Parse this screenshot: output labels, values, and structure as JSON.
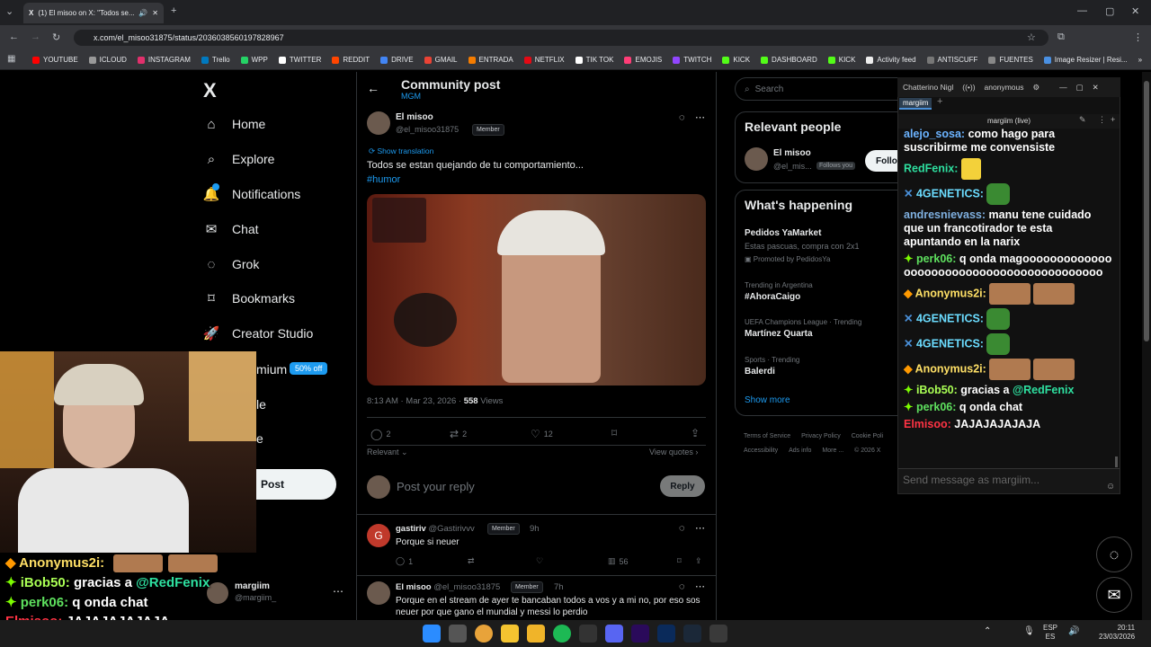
{
  "browser": {
    "tab_title": "(1) El misoo on X: \"Todos se...",
    "url": "x.com/el_misoo31875/status/2036038560197828967",
    "bookmarks": [
      "YOUTUBE",
      "ICLOUD",
      "INSTAGRAM",
      "Trello",
      "WPP",
      "TWITTER",
      "REDDIT",
      "DRIVE",
      "GMAIL",
      "ENTRADA",
      "NETFLIX",
      "TIK TOK",
      "EMOJIS",
      "TWITCH",
      "KICK",
      "DASHBOARD",
      "KICK",
      "Activity feed",
      "ANTISCUFF",
      "FUENTES",
      "Image Resizer | Resi..."
    ]
  },
  "sidebar": {
    "logo": "X",
    "items": [
      {
        "label": "Home",
        "icon": "⌂"
      },
      {
        "label": "Explore",
        "icon": "⌕"
      },
      {
        "label": "Notifications",
        "icon": "🔔"
      },
      {
        "label": "Chat",
        "icon": "✉"
      },
      {
        "label": "Grok",
        "icon": "◌"
      },
      {
        "label": "Bookmarks",
        "icon": "⌑"
      },
      {
        "label": "Creator Studio",
        "icon": "🚀"
      },
      {
        "label": "Premium",
        "icon": "X"
      },
      {
        "label": "Profile",
        "icon": "☺"
      },
      {
        "label": "More",
        "icon": "⋯"
      }
    ],
    "premium_visible": "mium",
    "premium_badge": "50% off",
    "profile_visible": "le",
    "more_visible": "e",
    "post_button": "Post",
    "account_name": "margiim",
    "account_handle": "@margiim_"
  },
  "header": {
    "title": "Community post",
    "subtitle": "MGM"
  },
  "post": {
    "author": "El misoo",
    "handle": "@el_misoo31875",
    "badge": "Member",
    "show_translation": "Show translation",
    "text": "Todos se estan quejando de tu comportamiento...",
    "hashtag": "#humor",
    "timestamp": "8:13 AM · Mar 23, 2026 · ",
    "views_count": "558",
    "views_label": " Views",
    "replies": "2",
    "reposts": "2",
    "likes": "12",
    "sort": "Relevant",
    "view_quotes": "View quotes",
    "reply_placeholder": "Post your reply",
    "reply_button": "Reply"
  },
  "replies": [
    {
      "author": "gastiriv",
      "handle": "@Gastirivvv",
      "badge": "Member",
      "time": "9h",
      "text": "Porque si neuer",
      "replies": "1",
      "views": "56"
    },
    {
      "author": "El misoo",
      "handle": "@el_misoo31875",
      "badge": "Member",
      "time": "7h",
      "text": "Porque en el stream de ayer te bancaban todos a vos y a mi no, por eso sos neuer por que gano el mundial y messi lo perdio"
    }
  ],
  "right": {
    "search_placeholder": "Search",
    "relevant_title": "Relevant people",
    "rp_name": "El misoo",
    "rp_handle": "@el_mis...",
    "rp_follows": "Follows you",
    "rp_follow": "Follo",
    "happening_title": "What's happening",
    "trends": [
      {
        "meta": "",
        "name": "Pedidos YaMarket",
        "desc": "Estas pascuas, compra con 2x1",
        "promo": "Promoted by PedidosYa"
      },
      {
        "meta": "Trending in Argentina",
        "name": "#AhoraCaigo"
      },
      {
        "meta": "UEFA Champions League · Trending",
        "name": "Martínez Quarta"
      },
      {
        "meta": "Sports · Trending",
        "name": "Balerdi"
      }
    ],
    "show_more": "Show more",
    "footer": [
      "Terms of Service",
      "Privacy Policy",
      "Cookie Poli",
      "Accessibility",
      "Ads info",
      "More ...",
      "© 2026 X"
    ]
  },
  "chatterino": {
    "title": "Chatterino Nigl",
    "user": "anonymous",
    "tab": "margiim",
    "channel": "margiim (live)",
    "input_placeholder": "Send message as margiim...",
    "lines": [
      {
        "user": "alejo_sosa:",
        "color": "#6bb3ff",
        "text": "como hago para suscribirme me convensiste"
      },
      {
        "user": "RedFenix:",
        "color": "#2ee0a0",
        "text": ""
      },
      {
        "user": "4GENETICS:",
        "color": "#6bdcff",
        "text": ""
      },
      {
        "user": "andresnievass:",
        "color": "#7fb0e0",
        "text": "manu tene cuidado que un francotirador te esta apuntando en la narix"
      },
      {
        "user": "perk06:",
        "color": "#5ee05e",
        "text": "q onda magoooooooooooooooooooooooooooooooooooooooooo"
      },
      {
        "user": "Anonymus2i:",
        "color": "#ffe066",
        "text": ""
      },
      {
        "user": "4GENETICS:",
        "color": "#6bdcff",
        "text": ""
      },
      {
        "user": "4GENETICS:",
        "color": "#6bdcff",
        "text": ""
      },
      {
        "user": "Anonymus2i:",
        "color": "#ffe066",
        "text": ""
      },
      {
        "user": "iBob50:",
        "color": "#aaff55",
        "text": "gracias a @RedFenix"
      },
      {
        "user": "perk06:",
        "color": "#5ee05e",
        "text": "q onda chat"
      },
      {
        "user": "Elmisoo:",
        "color": "#ff3344",
        "text": "JAJAJAJAJAJA"
      }
    ]
  },
  "overlay": [
    {
      "user": "Anonymus2i:",
      "color": "#ffe066",
      "text": ""
    },
    {
      "user": "iBob50:",
      "color": "#aaff55",
      "text": "gracias a ",
      "mention": "@RedFenix"
    },
    {
      "user": "perk06:",
      "color": "#5ee05e",
      "text": "q onda chat"
    },
    {
      "user": "Elmisoo:",
      "color": "#ff3344",
      "text": "JAJAJAJAJAJA"
    }
  ],
  "taskbar": {
    "lang": "ESP",
    "lang2": "ES",
    "time": "20:11",
    "date": "23/03/2026"
  }
}
